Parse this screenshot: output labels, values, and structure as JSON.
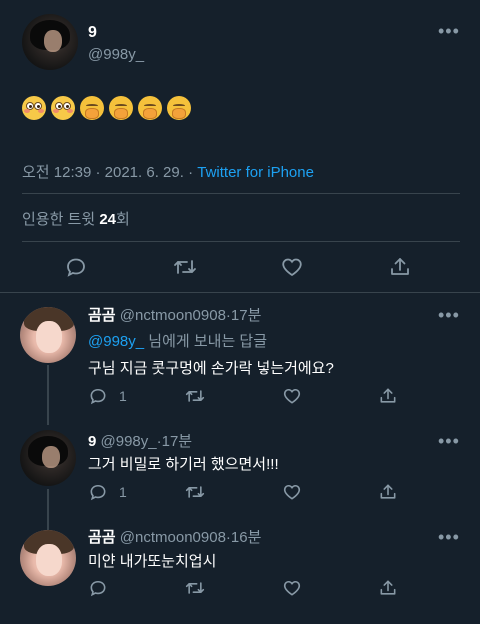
{
  "main_tweet": {
    "display_name": "9",
    "handle": "@998y_",
    "emojis": [
      "flushed-face",
      "flushed-face",
      "face-with-hand-over-mouth",
      "face-with-hand-over-mouth",
      "face-with-hand-over-mouth",
      "face-with-hand-over-mouth"
    ],
    "time": "오전 12:39",
    "separator1": "·",
    "date": "2021. 6. 29.",
    "separator2": "·",
    "source": "Twitter for iPhone",
    "quote_label": "인용한 트윗",
    "quote_count": "24",
    "quote_suffix": "회"
  },
  "replies": [
    {
      "display_name": "곰곰",
      "handle": "@nctmoon0908",
      "dot": "·",
      "time": "17분",
      "reply_to_handle": "@998y_",
      "reply_to_text": "님에게 보내는 답글",
      "text": "구님 지금 콧구멍에 손가락 넣는거에요?",
      "reply_count": "1"
    },
    {
      "display_name": "9",
      "handle": "@998y_",
      "dot": "·",
      "time": "17분",
      "text": "그거 비밀로 하기러 했으면서!!!",
      "reply_count": "1"
    },
    {
      "display_name": "곰곰",
      "handle": "@nctmoon0908",
      "dot": "·",
      "time": "16분",
      "text": "미얀 내가또눈치업시",
      "reply_count": ""
    }
  ],
  "icons": [
    "more-icon",
    "reply-icon",
    "retweet-icon",
    "like-icon",
    "share-icon"
  ],
  "colors": {
    "background": "#15202b",
    "accent": "#1da1f2",
    "muted": "#8899a6",
    "divider": "#38444d"
  }
}
